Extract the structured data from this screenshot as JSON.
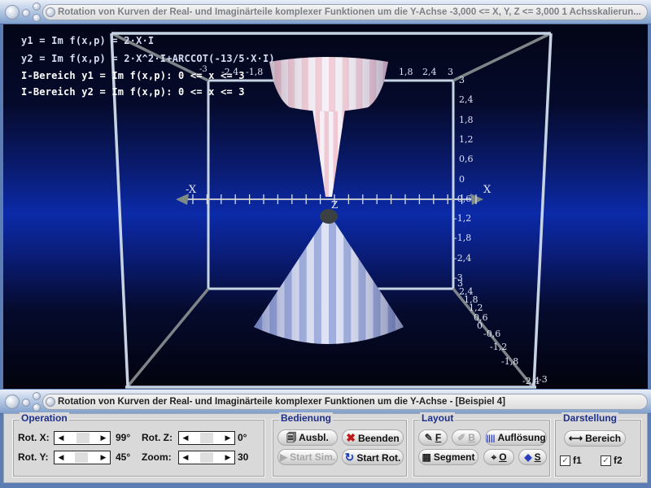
{
  "window": {
    "top_title": "Rotation von Kurven der Real- und Imaginärteile komplexer Funktionen um die Y-Achse   -3,000 <= X, Y, Z <= 3,000    1 Achsskalierun...",
    "bottom_title": "Rotation von Kurven der Real- und Imaginärteile komplexer Funktionen um die Y-Achse - [Beispiel 4]"
  },
  "viewport": {
    "formulas": [
      "y1 = Im f(x,p) =  2·X·I",
      "y2 = Im f(x,p) = 2·X^2·I+ARCCOT(-13/5·X·I)",
      "I-Bereich y1 = Im f(x,p): 0 <= x <= 3",
      "I-Bereich y2 = Im f(x,p): 0 <= x <= 3"
    ],
    "top_axis_ticks_left": [
      "-3",
      "-2,4",
      "-1,8"
    ],
    "top_axis_ticks_right": [
      "1,8",
      "2,4",
      "3"
    ],
    "right_axis_ticks": [
      "3",
      "2,4",
      "1,8",
      "1,2",
      "0,6",
      "0",
      "-0,6",
      "-1,2",
      "-1,8",
      "-2,4",
      "-3"
    ],
    "diagonal_axis_ticks": [
      "3",
      "2,4",
      "1,8",
      "1,2",
      "0,6",
      "0",
      "-0,6",
      "-1,2",
      "-1,8",
      "-2,4",
      "-3"
    ],
    "axis_letters": {
      "neg_x": "-X",
      "pos_x": "X",
      "z": "Z",
      "y_top": "3"
    },
    "surface_colors": {
      "upper_a": "#f0c8d4",
      "upper_b": "#f4f0f6",
      "lower_a": "#8fa0d8",
      "lower_b": "#d9def2"
    }
  },
  "panel": {
    "operation": {
      "title": "Operation",
      "rot_x": {
        "label": "Rot. X:",
        "value": "99°",
        "fraction": 0.55
      },
      "rot_y": {
        "label": "Rot. Y:",
        "value": "45°",
        "fraction": 0.45
      },
      "rot_z": {
        "label": "Rot. Z:",
        "value": "0°",
        "fraction": 0.5
      },
      "zoom": {
        "label": "Zoom:",
        "value": "30",
        "fraction": 0.5
      }
    },
    "bedienung": {
      "title": "Bedienung",
      "ausbl": "Ausbl.",
      "beenden": "Beenden",
      "start_sim": "Start Sim.",
      "start_rot": "Start Rot."
    },
    "layout": {
      "title": "Layout",
      "f": "F",
      "b": "B",
      "aufloesung": "Auflösung",
      "segment": "Segment",
      "o": "O",
      "s": "S"
    },
    "darstellung": {
      "title": "Darstellung",
      "bereich": "Bereich",
      "f1": {
        "label": "f1",
        "checked": true
      },
      "f2": {
        "label": "f2",
        "checked": true
      }
    }
  }
}
